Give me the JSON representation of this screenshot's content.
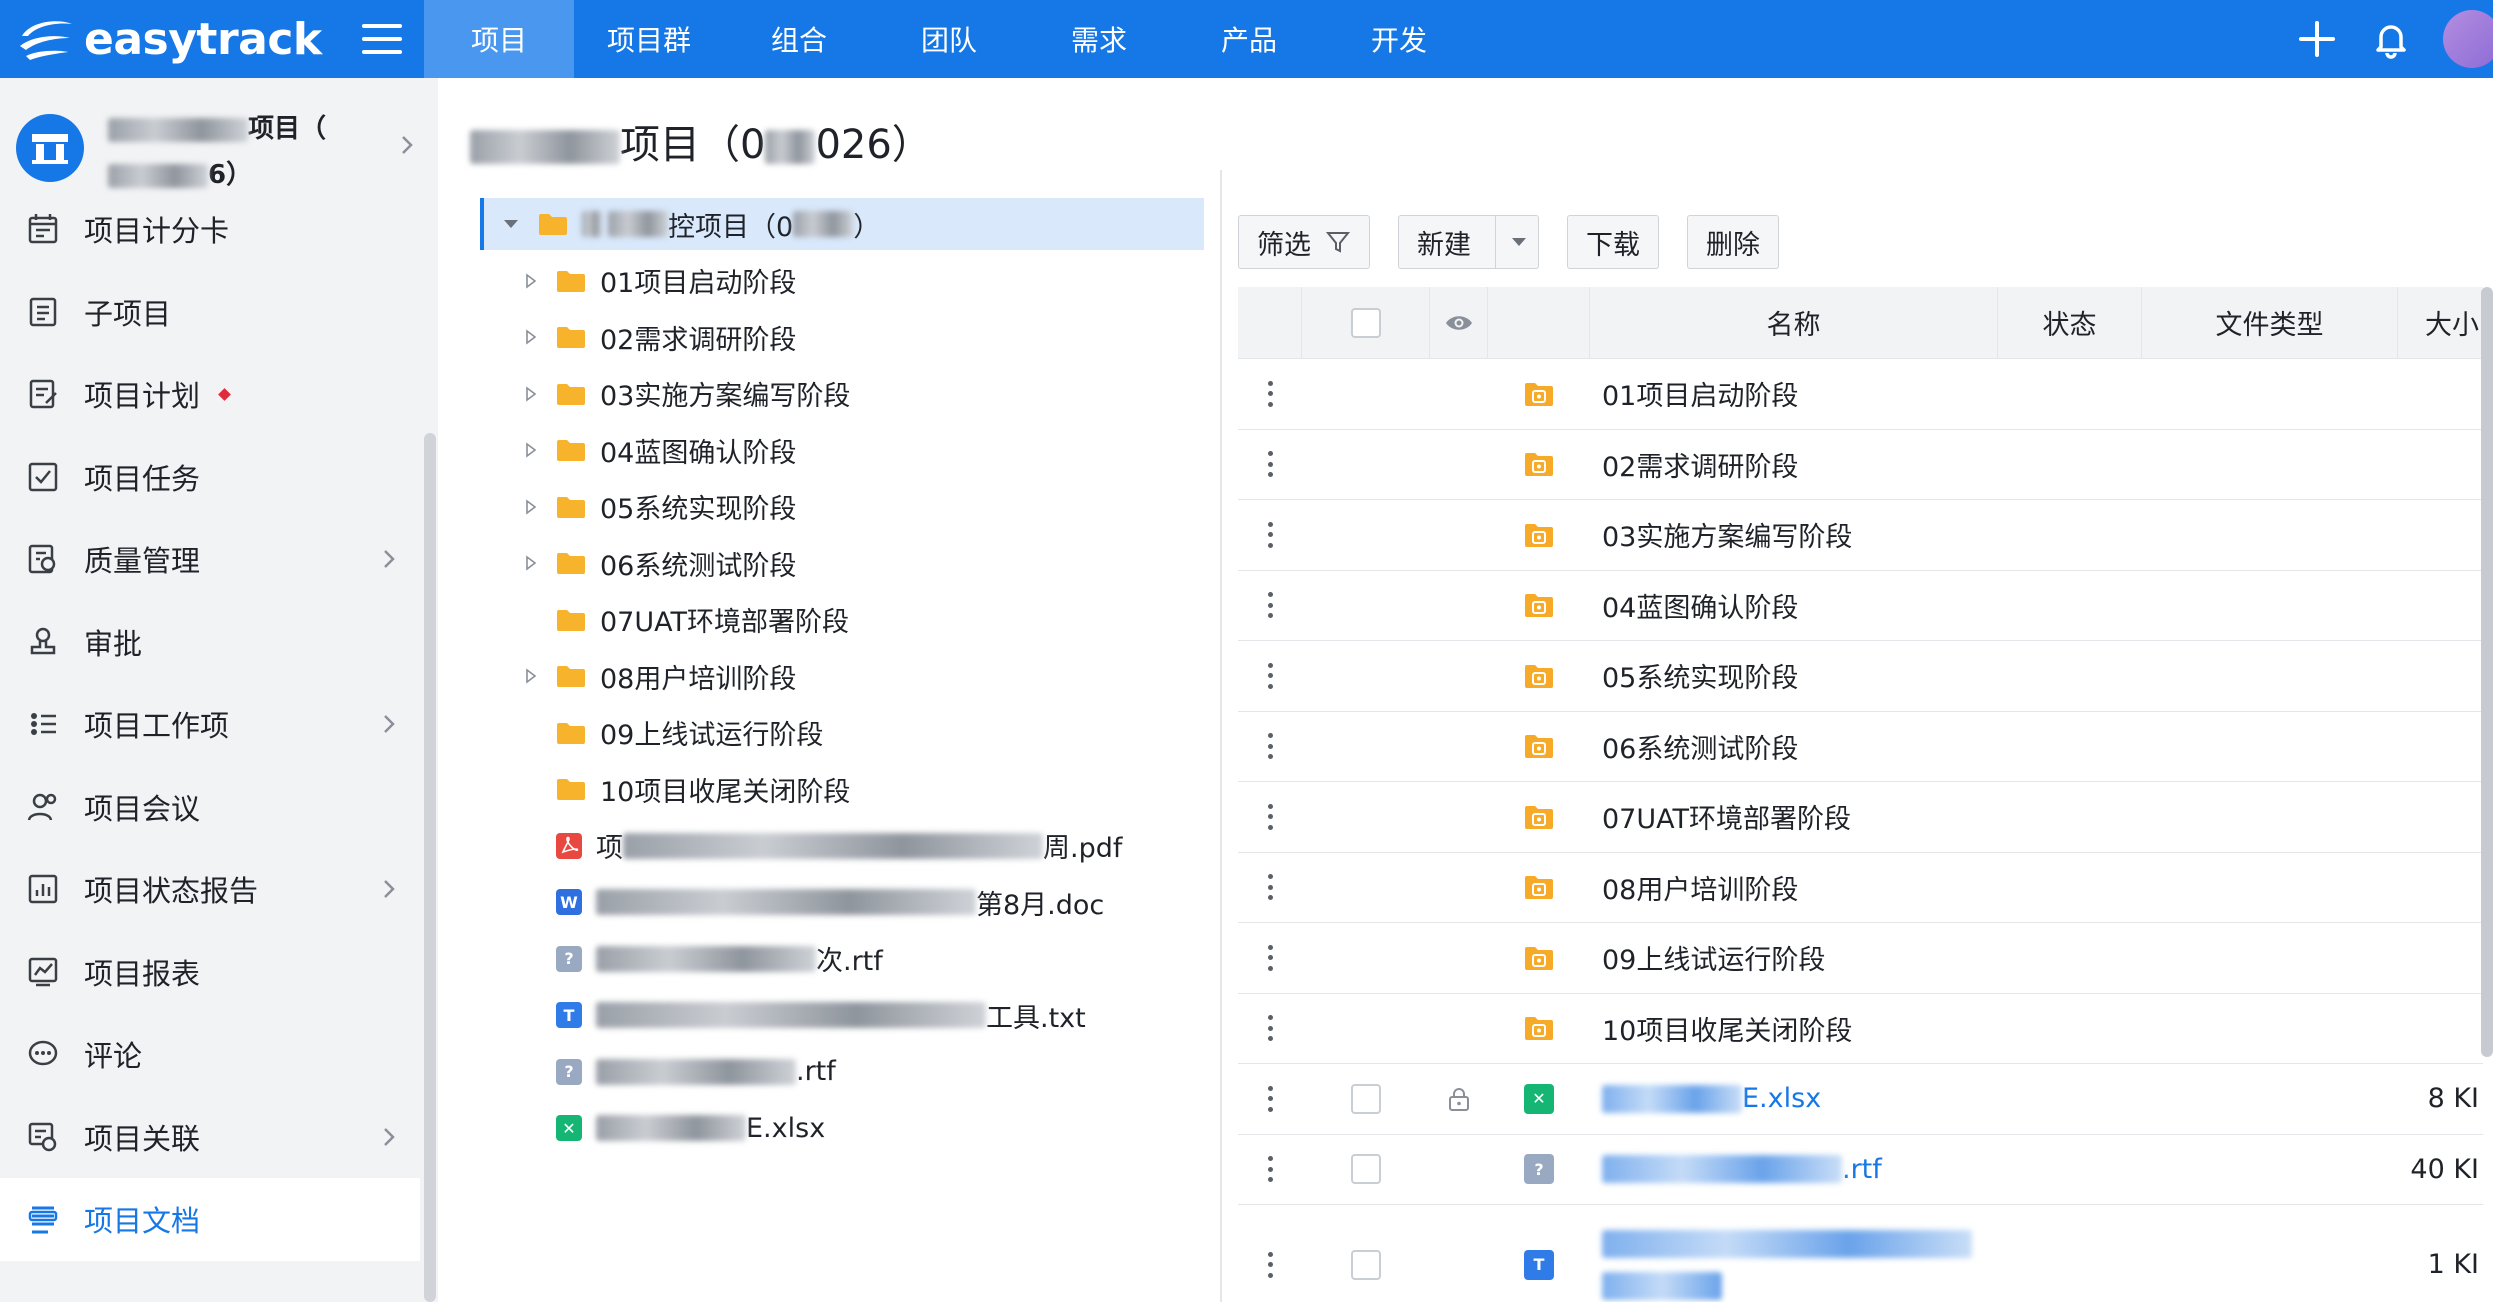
{
  "topbar": {
    "logo_text": "easytrack",
    "nav": [
      "项目",
      "项目群",
      "组合",
      "团队",
      "需求",
      "产品",
      "开发"
    ],
    "active_nav": 0
  },
  "sidebar": {
    "project_name_line1": "项目（",
    "project_name_line2": "6）",
    "items": [
      {
        "label": "项目计分卡",
        "icon": "scorecard-icon",
        "arrow": false,
        "dot": false
      },
      {
        "label": "子项目",
        "icon": "subproject-icon",
        "arrow": false,
        "dot": false
      },
      {
        "label": "项目计划",
        "icon": "plan-icon",
        "arrow": false,
        "dot": true
      },
      {
        "label": "项目任务",
        "icon": "task-icon",
        "arrow": false,
        "dot": false
      },
      {
        "label": "质量管理",
        "icon": "quality-icon",
        "arrow": true,
        "dot": false
      },
      {
        "label": "审批",
        "icon": "approval-icon",
        "arrow": false,
        "dot": false
      },
      {
        "label": "项目工作项",
        "icon": "workitem-icon",
        "arrow": true,
        "dot": false
      },
      {
        "label": "项目会议",
        "icon": "meeting-icon",
        "arrow": false,
        "dot": false
      },
      {
        "label": "项目状态报告",
        "icon": "status-report-icon",
        "arrow": true,
        "dot": false
      },
      {
        "label": "项目报表",
        "icon": "report-icon",
        "arrow": false,
        "dot": false
      },
      {
        "label": "评论",
        "icon": "comment-icon",
        "arrow": false,
        "dot": false
      },
      {
        "label": "项目关联",
        "icon": "link-icon",
        "arrow": true,
        "dot": false
      },
      {
        "label": "项目文档",
        "icon": "document-icon",
        "arrow": false,
        "dot": false
      }
    ],
    "active_index": 12
  },
  "main": {
    "title_mid": "项目（0",
    "title_end": "026）",
    "tree": {
      "root_mid": "控项目（0",
      "root_end": "）",
      "folders": [
        {
          "label": "01项目启动阶段",
          "expandable": true
        },
        {
          "label": "02需求调研阶段",
          "expandable": true
        },
        {
          "label": "03实施方案编写阶段",
          "expandable": true
        },
        {
          "label": "04蓝图确认阶段",
          "expandable": true
        },
        {
          "label": "05系统实现阶段",
          "expandable": true
        },
        {
          "label": "06系统测试阶段",
          "expandable": true
        },
        {
          "label": "07UAT环境部署阶段",
          "expandable": false
        },
        {
          "label": "08用户培训阶段",
          "expandable": true
        },
        {
          "label": "09上线试运行阶段",
          "expandable": false
        },
        {
          "label": "10项目收尾关闭阶段",
          "expandable": false
        }
      ],
      "files": [
        {
          "prefix": "项",
          "suffix": "周.pdf",
          "type": "pdf"
        },
        {
          "prefix": "",
          "suffix": "第8月.doc",
          "type": "doc"
        },
        {
          "prefix": "",
          "suffix": "次.rtf",
          "type": "rtf"
        },
        {
          "prefix": "",
          "suffix": "工具.txt",
          "type": "txt"
        },
        {
          "prefix": "",
          "suffix": ".rtf",
          "type": "rtf"
        },
        {
          "prefix": "",
          "suffix": "E.xlsx",
          "type": "xlsx"
        }
      ]
    },
    "toolbar": {
      "filter": "筛选",
      "new": "新建",
      "download": "下载",
      "delete": "删除"
    },
    "table": {
      "headers": {
        "name": "名称",
        "status": "状态",
        "type": "文件类型",
        "size": "大小"
      },
      "folder_rows": [
        "01项目启动阶段",
        "02需求调研阶段",
        "03实施方案编写阶段",
        "04蓝图确认阶段",
        "05系统实现阶段",
        "06系统测试阶段",
        "07UAT环境部署阶段",
        "08用户培训阶段",
        "09上线试运行阶段",
        "10项目收尾关闭阶段"
      ],
      "file_rows": [
        {
          "suffix": "E.xlsx",
          "size": "8 KI",
          "type": "xlsx",
          "locked": true
        },
        {
          "suffix": ".rtf",
          "size": "40 KI",
          "type": "rtf",
          "locked": false
        },
        {
          "suffix": "",
          "size": "1 KI",
          "type": "txt",
          "locked": false
        }
      ]
    }
  },
  "colors": {
    "brand": "#1677e6",
    "folder": "#f7b32b",
    "pdf": "#e8483f",
    "doc": "#2f6fe0",
    "txt": "#2f7be8",
    "xlsx": "#15b573",
    "rtf": "#9aa9c2"
  }
}
